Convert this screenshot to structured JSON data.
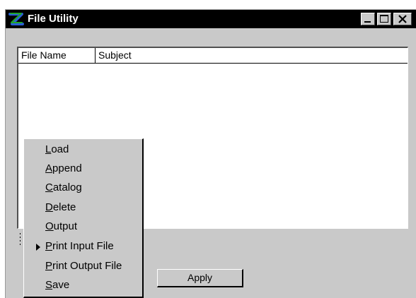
{
  "window": {
    "title": "File Utility",
    "controls": {
      "minimize": "minimize",
      "maximize": "maximize",
      "close": "close"
    }
  },
  "list": {
    "columns": [
      "File Name",
      "Subject"
    ],
    "rows": []
  },
  "apply_label": "Apply",
  "menu": {
    "items": [
      {
        "mnemonic": "L",
        "rest": "oad"
      },
      {
        "mnemonic": "A",
        "rest": "ppend"
      },
      {
        "mnemonic": "C",
        "rest": "atalog"
      },
      {
        "mnemonic": "D",
        "rest": "elete"
      },
      {
        "mnemonic": "O",
        "rest": "utput"
      },
      {
        "mnemonic": "P",
        "rest": "rint Input File",
        "has_submenu": true
      },
      {
        "mnemonic": "P",
        "rest": "rint Output File"
      },
      {
        "mnemonic": "S",
        "rest": "ave"
      }
    ]
  },
  "colors": {
    "titlebar_bg": "#000000",
    "window_bg": "#c9c9c9",
    "icon_green": "#1fa52a",
    "icon_blue": "#2a5fd6"
  }
}
